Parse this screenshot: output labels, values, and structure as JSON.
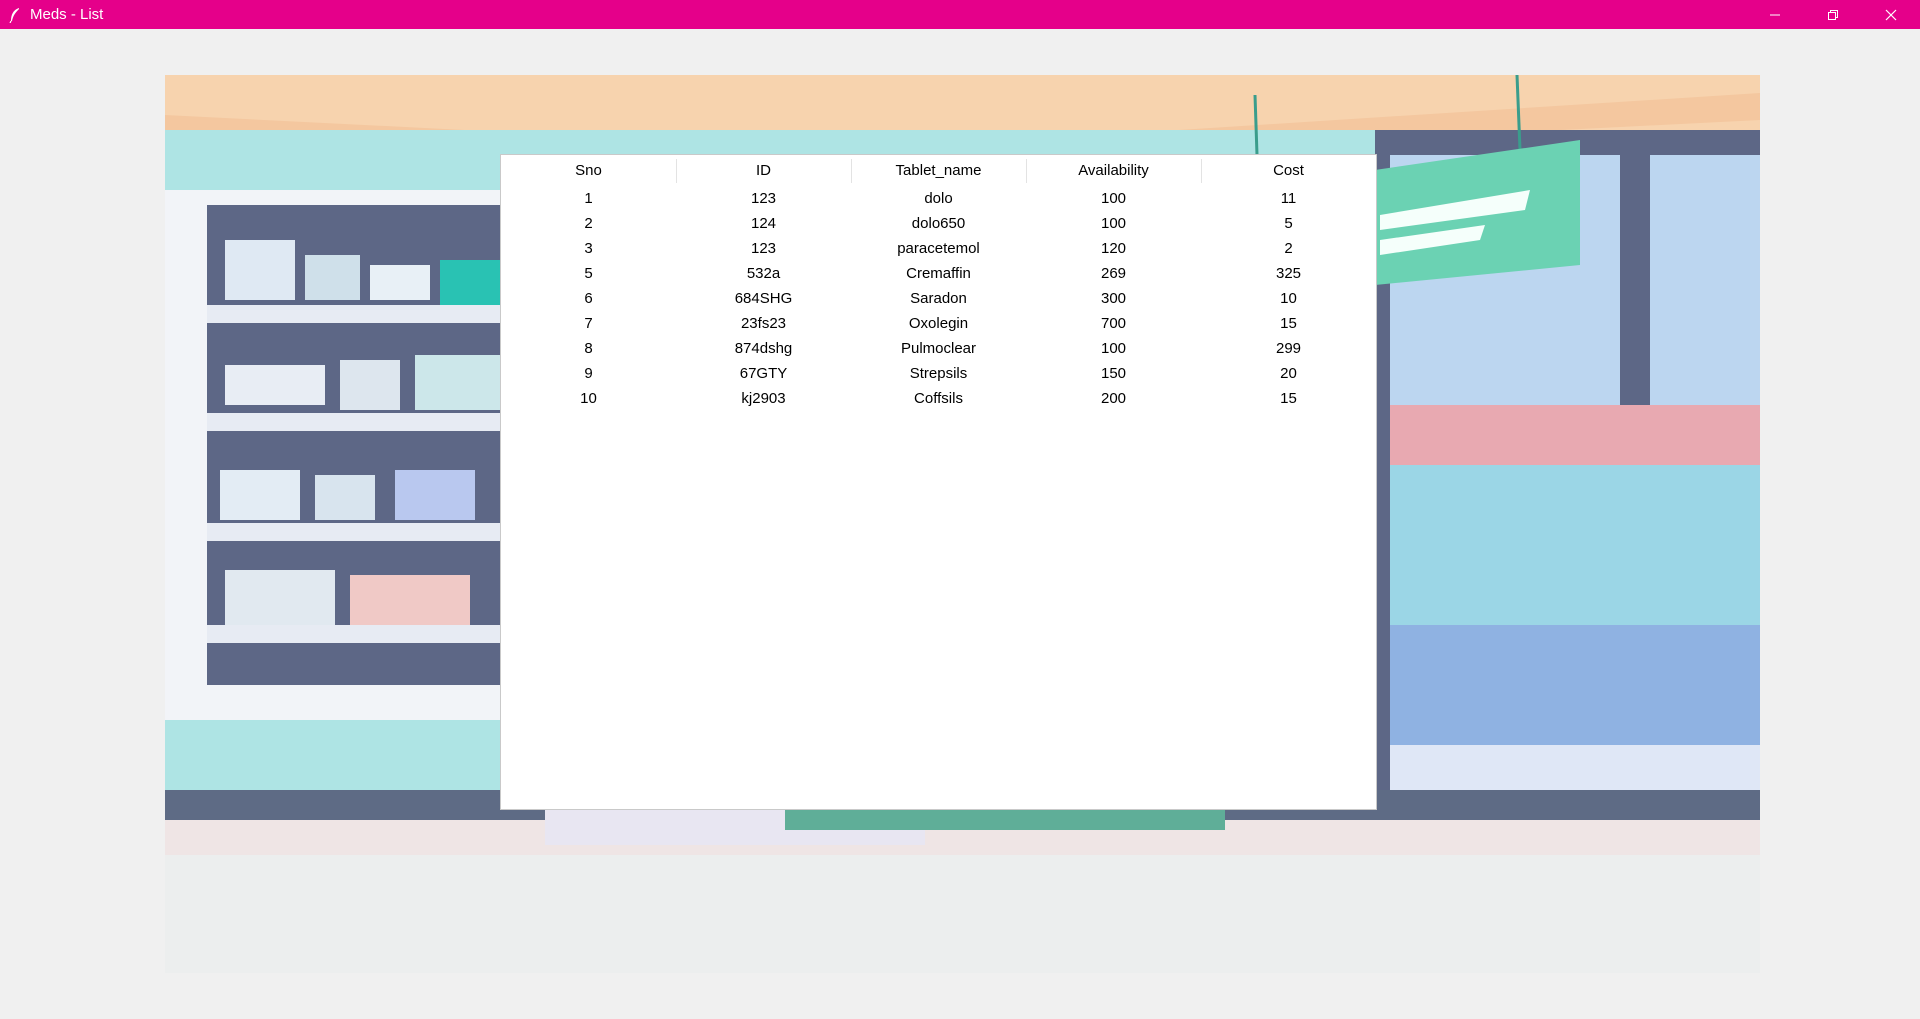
{
  "window": {
    "title": "Meds - List",
    "app_icon": "feather-icon",
    "controls": [
      "minimize-icon",
      "restore-icon",
      "close-icon"
    ],
    "titlebar_color": "#e5008a"
  },
  "table": {
    "columns": [
      "Sno",
      "ID",
      "Tablet_name",
      "Availability",
      "Cost"
    ],
    "rows": [
      [
        "1",
        "123",
        "dolo",
        "100",
        "11"
      ],
      [
        "2",
        "124",
        "dolo650",
        "100",
        "5"
      ],
      [
        "3",
        "123",
        "paracetemol",
        "120",
        "2"
      ],
      [
        "5",
        "532a",
        "Cremaffin",
        "269",
        "325"
      ],
      [
        "6",
        "684SHG",
        "Saradon",
        "300",
        "10"
      ],
      [
        "7",
        "23fs23",
        "Oxolegin",
        "700",
        "15"
      ],
      [
        "8",
        "874dshg",
        "Pulmoclear",
        "100",
        "299"
      ],
      [
        "9",
        "67GTY",
        "Strepsils",
        "150",
        "20"
      ],
      [
        "10",
        "kj2903",
        "Coffsils",
        "200",
        "15"
      ]
    ]
  }
}
